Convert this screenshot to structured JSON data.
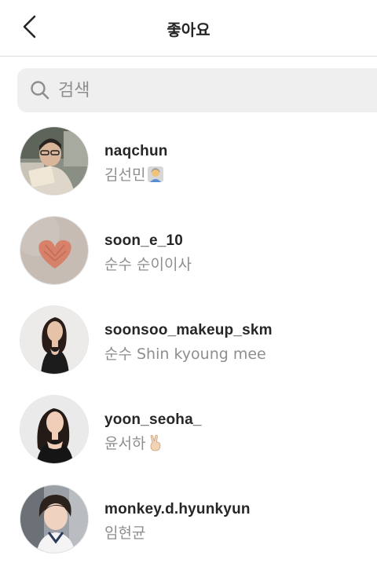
{
  "header": {
    "title": "좋아요",
    "back_icon": "chevron-left-icon"
  },
  "search": {
    "placeholder": "검색",
    "value": "",
    "icon": "search-icon"
  },
  "likers": [
    {
      "username": "naqchun",
      "full_name": "김선민",
      "badge": "person-emoji-icon"
    },
    {
      "username": "soon_e_10",
      "full_name": "순수 순이이사"
    },
    {
      "username": "soonsoo_makeup_skm",
      "full_name": "순수 Shin kyoung mee"
    },
    {
      "username": "yoon_seoha_",
      "full_name": "윤서하",
      "badge": "victory-hand-emoji-icon"
    },
    {
      "username": "monkey.d.hyunkyun",
      "full_name": "임현균"
    }
  ],
  "colors": {
    "text_primary": "#262626",
    "text_secondary": "#8e8e8e",
    "search_bg": "#efeff0",
    "divider": "#dbdbdb"
  }
}
